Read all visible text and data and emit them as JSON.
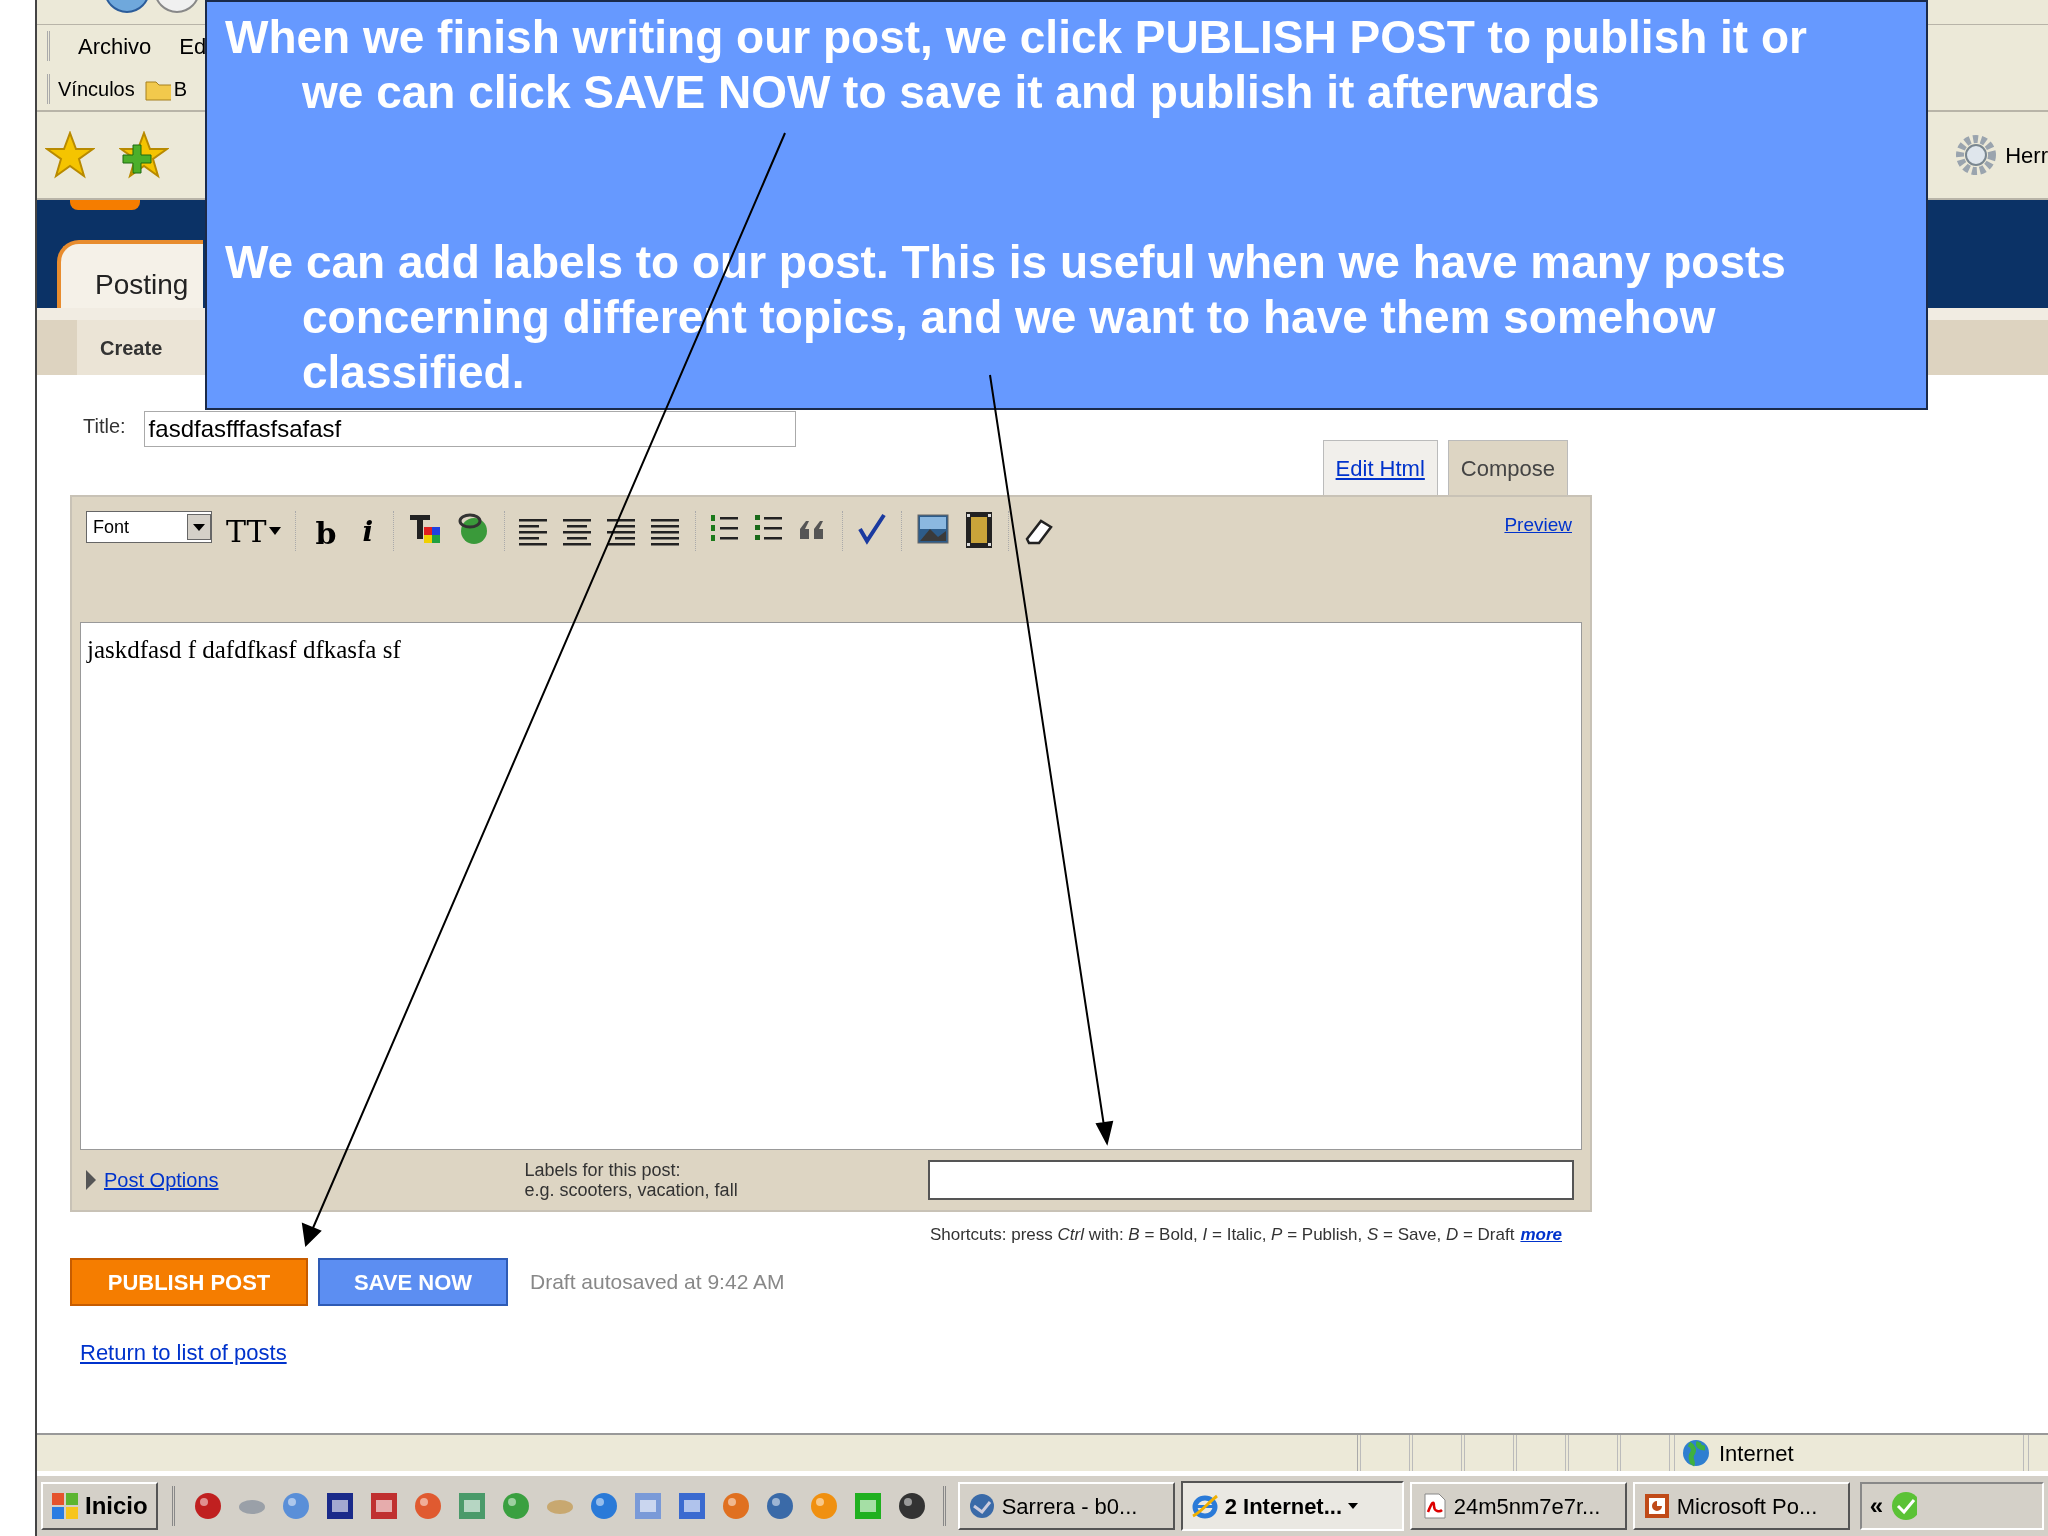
{
  "browser": {
    "menu": [
      "Archivo",
      "Ed"
    ],
    "links_label": "Vínculos",
    "links_folder": "B",
    "tools_label": "Herr"
  },
  "blogger": {
    "tab": "Posting",
    "subnav": "Create",
    "title_label": "Title:",
    "title_value": "fasdfasfffasfsafasf",
    "mode_tabs": [
      {
        "label": "Edit Html",
        "selected": false
      },
      {
        "label": "Compose",
        "selected": true
      }
    ],
    "font_select": "Font",
    "size_glyph": "TT",
    "bold_glyph": "b",
    "italic_glyph": "i",
    "preview": "Preview",
    "body": "jaskdfasd f dafdfkasf dfkasfa sf",
    "post_options": "Post Options",
    "labels_title": "Labels for this post:",
    "labels_hint": "e.g. scooters, vacation, fall",
    "shortcuts": "Shortcuts: press *Ctrl* with: *B* = Bold, *I* = Italic, *P* = Publish, *S* = Save, *D* = Draft",
    "shortcuts_more": "more",
    "publish": "PUBLISH POST",
    "save": "SAVE NOW",
    "autosave": "Draft autosaved at 9:42 AM",
    "return_link": "Return to list of posts"
  },
  "status_bar": {
    "zone": "Internet"
  },
  "taskbar": {
    "start": "Inicio",
    "tasks": [
      {
        "label": "Sarrera - b0...",
        "selected": false,
        "kind": "mail"
      },
      {
        "label": "2 Internet...",
        "selected": true,
        "kind": "browser"
      },
      {
        "label": "24m5nm7e7r...",
        "selected": false,
        "kind": "pdf"
      },
      {
        "label": "Microsoft Po...",
        "selected": false,
        "kind": "slides"
      }
    ],
    "tray_chevron": "«"
  },
  "callout": {
    "paragraphs": [
      "When we finish writing our post, we click PUBLISH POST to publish it or we can click SAVE NOW to save it and publish it afterwards",
      "We can add labels to our post. This is useful when we have many posts concerning different topics, and we want to have them somehow classified."
    ]
  }
}
